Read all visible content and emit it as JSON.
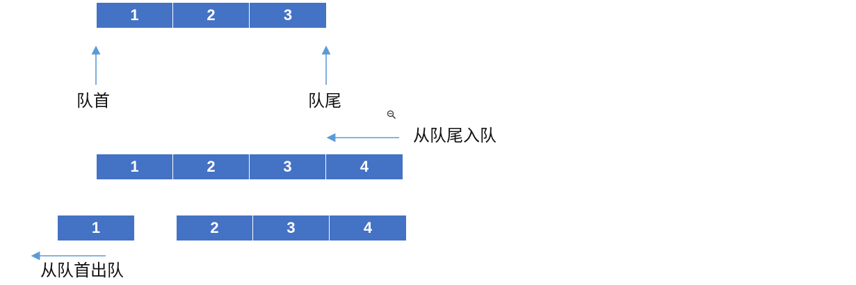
{
  "queue_initial": {
    "items": [
      "1",
      "2",
      "3"
    ],
    "front_label": "队首",
    "rear_label": "队尾"
  },
  "enqueue": {
    "label": "从队尾入队",
    "items": [
      "1",
      "2",
      "3",
      "4"
    ]
  },
  "dequeue": {
    "label": "从队首出队",
    "removed_item": "1",
    "remaining_items": [
      "2",
      "3",
      "4"
    ]
  },
  "colors": {
    "box_fill": "#4472c4",
    "box_text": "#ffffff",
    "arrow": "#5b9bd5"
  },
  "icons": {
    "zoom": "zoom-out-icon"
  }
}
